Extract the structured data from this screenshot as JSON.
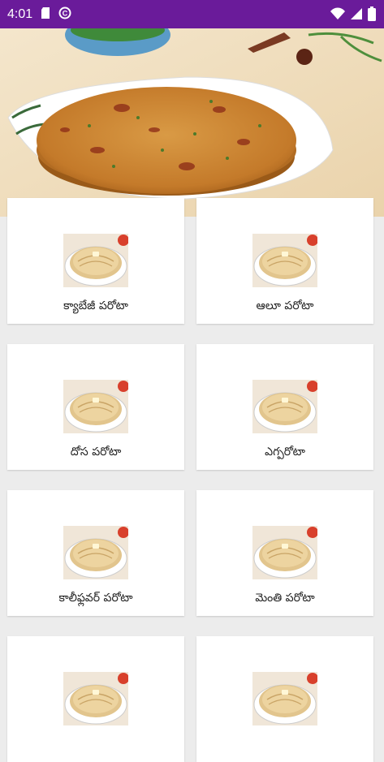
{
  "status_bar": {
    "time": "4:01"
  },
  "recipes": [
    {
      "label": "క్యాబేజీ పరోటా"
    },
    {
      "label": "ఆలూ పరోటా"
    },
    {
      "label": "దోస పరోటా"
    },
    {
      "label": "ఎగ్పరోటా"
    },
    {
      "label": "కాలీఫ్లవర్ పరోటా"
    },
    {
      "label": "మెంతి పరోటా"
    },
    {
      "label": ""
    },
    {
      "label": ""
    }
  ]
}
